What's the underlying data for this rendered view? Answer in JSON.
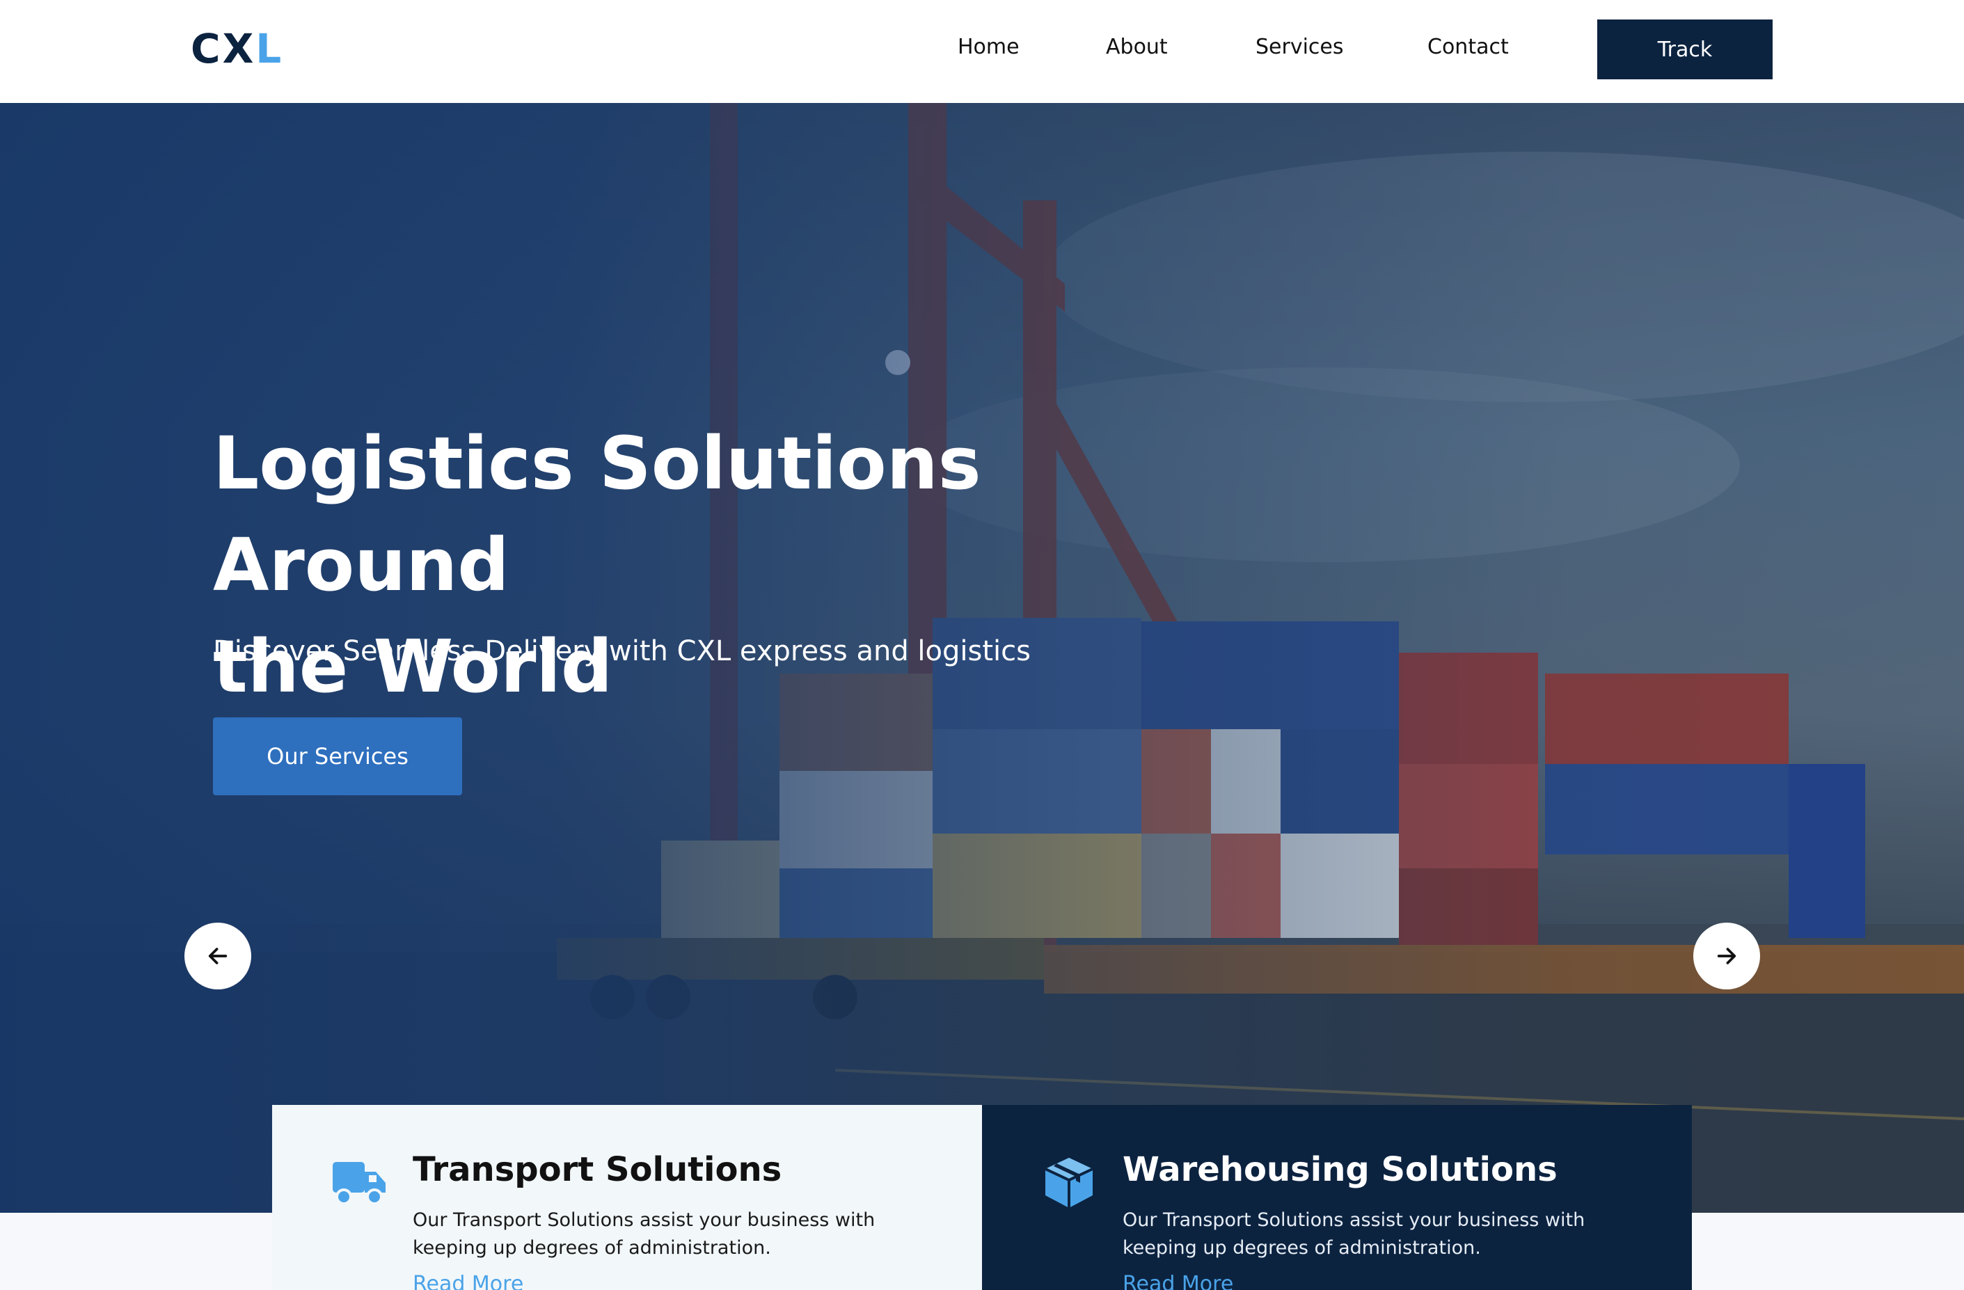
{
  "header": {
    "logo_main": "CX",
    "logo_accent": "L",
    "nav": [
      {
        "label": "Home"
      },
      {
        "label": "About"
      },
      {
        "label": "Services"
      },
      {
        "label": "Contact"
      }
    ],
    "track_label": "Track"
  },
  "hero": {
    "title_line1": "Logistics Solutions Around",
    "title_line2": "the World",
    "subtitle": "Discover Seamless Delivery with CXL express and logistics",
    "cta_label": "Our Services",
    "prev_icon": "arrow-left-icon",
    "next_icon": "arrow-right-icon"
  },
  "cards": [
    {
      "icon": "truck-icon",
      "title": "Transport Solutions",
      "description": "Our Transport Solutions assist your business with keeping up degrees of administration.",
      "link": "Read More"
    },
    {
      "icon": "box-icon",
      "title": "Warehousing Solutions",
      "description": "Our Transport Solutions assist your business with keeping up degrees of administration.",
      "link": "Read More"
    }
  ],
  "colors": {
    "navy": "#0c2340",
    "accent_blue": "#4aa3e8",
    "button_blue": "#2e6fbe",
    "light_card": "#f2f7fa"
  }
}
